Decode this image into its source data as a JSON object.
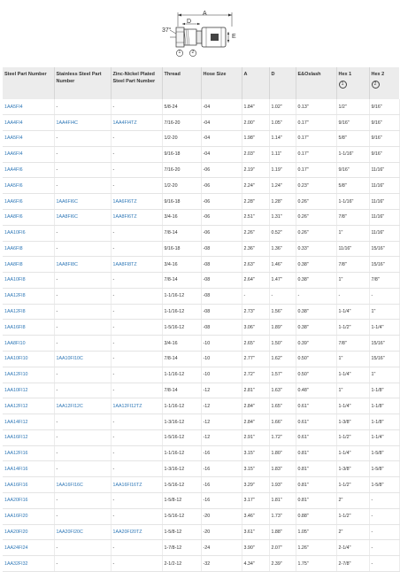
{
  "diagram": {
    "angle_label": "37°",
    "dim_a": "A",
    "dim_d": "D",
    "dim_e": "E",
    "marker_1": "1",
    "marker_2": "2"
  },
  "table": {
    "headers": {
      "steel": "Steel Part Number",
      "stainless": "Stainless Steel Part Number",
      "zinc": "Zinc-Nickel Plated Steel Part Number",
      "thread": "Thread",
      "hose": "Hose Size",
      "a": "A",
      "d": "D",
      "e": "E&Oslash",
      "hex1": "Hex 1",
      "hex1_icon": "1",
      "hex2": "Hex 2",
      "hex2_icon": "2"
    },
    "rows": [
      [
        "1AA5FI4",
        "-",
        "-",
        "5/8-24",
        "-04",
        "1.84\"",
        "1.02\"",
        "0.13\"",
        "1/2\"",
        "9/16\""
      ],
      [
        "1AA4FI4",
        "1AA4FI4C",
        "1AA4FI4TZ",
        "7/16-20",
        "-04",
        "2.00\"",
        "1.05\"",
        "0.17\"",
        "9/16\"",
        "9/16\""
      ],
      [
        "1AA5FI4",
        "-",
        "-",
        "1/2-20",
        "-04",
        "1.98\"",
        "1.14\"",
        "0.17\"",
        "5/8\"",
        "9/16\""
      ],
      [
        "1AA6FI4",
        "-",
        "-",
        "9/16-18",
        "-04",
        "2.03\"",
        "1.11\"",
        "0.17\"",
        "1-1/16\"",
        "9/16\""
      ],
      [
        "1AA4FI6",
        "-",
        "-",
        "7/16-20",
        "-06",
        "2.19\"",
        "1.19\"",
        "0.17\"",
        "9/16\"",
        "11/16\""
      ],
      [
        "1AA5FI6",
        "-",
        "-",
        "1/2-20",
        "-06",
        "2.24\"",
        "1.24\"",
        "0.23\"",
        "5/8\"",
        "11/16\""
      ],
      [
        "1AA6FI6",
        "1AA6FI6C",
        "1AA6FI6TZ",
        "9/16-18",
        "-06",
        "2.28\"",
        "1.28\"",
        "0.26\"",
        "1-1/16\"",
        "11/16\""
      ],
      [
        "1AA8FI6",
        "1AA8FI6C",
        "1AA8FI6TZ",
        "3/4-16",
        "-06",
        "2.51\"",
        "1.31\"",
        "0.26\"",
        "7/8\"",
        "11/16\""
      ],
      [
        "1AA10FI6",
        "-",
        "-",
        "7/8-14",
        "-06",
        "2.26\"",
        "0.52\"",
        "0.26\"",
        "1\"",
        "11/16\""
      ],
      [
        "1AA6FI8",
        "-",
        "-",
        "9/16-18",
        "-08",
        "2.36\"",
        "1.36\"",
        "0.33\"",
        "11/16\"",
        "15/16\""
      ],
      [
        "1AA8FI8",
        "1AA8FI8C",
        "1AA8FI8TZ",
        "3/4-16",
        "-08",
        "2.63\"",
        "1.46\"",
        "0.38\"",
        "7/8\"",
        "15/16\""
      ],
      [
        "1AA10FI8",
        "-",
        "-",
        "7/8-14",
        "-08",
        "2.64\"",
        "1.47\"",
        "0.38\"",
        "1\"",
        "7/8\""
      ],
      [
        "1AA12FI8",
        "-",
        "-",
        "1-1/16-12",
        "-08",
        "-",
        "-",
        "-",
        "-",
        "-"
      ],
      [
        "1AA12FI8",
        "-",
        "-",
        "1-1/16-12",
        "-08",
        "2.73\"",
        "1.56\"",
        "0.38\"",
        "1-1/4\"",
        "1\""
      ],
      [
        "1AA16FI8",
        "-",
        "-",
        "1-5/16-12",
        "-08",
        "3.06\"",
        "1.89\"",
        "0.38\"",
        "1-1/2\"",
        "1-1/4\""
      ],
      [
        "1AA8FI10",
        "-",
        "-",
        "3/4-16",
        "-10",
        "2.65\"",
        "1.50\"",
        "0.39\"",
        "7/8\"",
        "15/16\""
      ],
      [
        "1AA10FI10",
        "1AA10FI10C",
        "-",
        "7/8-14",
        "-10",
        "2.77\"",
        "1.62\"",
        "0.50\"",
        "1\"",
        "15/16\""
      ],
      [
        "1AA12FI10",
        "-",
        "-",
        "1-1/16-12",
        "-10",
        "2.72\"",
        "1.57\"",
        "0.50\"",
        "1-1/4\"",
        "1\""
      ],
      [
        "1AA10FI12",
        "-",
        "-",
        "7/8-14",
        "-12",
        "2.81\"",
        "1.63\"",
        "0.48\"",
        "1\"",
        "1-1/8\""
      ],
      [
        "1AA12FI12",
        "1AA12FI12C",
        "1AA12FI12TZ",
        "1-1/16-12",
        "-12",
        "2.84\"",
        "1.65\"",
        "0.61\"",
        "1-1/4\"",
        "1-1/8\""
      ],
      [
        "1AA14FI12",
        "-",
        "-",
        "1-3/16-12",
        "-12",
        "2.84\"",
        "1.66\"",
        "0.61\"",
        "1-3/8\"",
        "1-1/8\""
      ],
      [
        "1AA16FI12",
        "-",
        "-",
        "1-5/16-12",
        "-12",
        "2.91\"",
        "1.72\"",
        "0.61\"",
        "1-1/2\"",
        "1-1/4\""
      ],
      [
        "1AA12FI16",
        "-",
        "-",
        "1-1/16-12",
        "-16",
        "3.15\"",
        "1.80\"",
        "0.81\"",
        "1-1/4\"",
        "1-5/8\""
      ],
      [
        "1AA14FI16",
        "-",
        "-",
        "1-3/16-12",
        "-16",
        "3.15\"",
        "1.83\"",
        "0.81\"",
        "1-3/8\"",
        "1-5/8\""
      ],
      [
        "1AA16FI16",
        "1AA16FI16C",
        "1AA16FI16TZ",
        "1-5/16-12",
        "-16",
        "3.29\"",
        "1.93\"",
        "0.81\"",
        "1-1/2\"",
        "1-5/8\""
      ],
      [
        "1AA20FI16",
        "-",
        "-",
        "1-5/8-12",
        "-16",
        "3.17\"",
        "1.81\"",
        "0.81\"",
        "2\"",
        "-"
      ],
      [
        "1AA16FI20",
        "-",
        "-",
        "1-5/16-12",
        "-20",
        "3.46\"",
        "1.73\"",
        "0.88\"",
        "1-1/2\"",
        "-"
      ],
      [
        "1AA20FI20",
        "1AA20FI20C",
        "1AA20FI20TZ",
        "1-5/8-12",
        "-20",
        "3.61\"",
        "1.88\"",
        "1.05\"",
        "2\"",
        "-"
      ],
      [
        "1AA24FI24",
        "-",
        "-",
        "1-7/8-12",
        "-24",
        "3.90\"",
        "2.07\"",
        "1.26\"",
        "2-1/4\"",
        "-"
      ],
      [
        "1AA32FI32",
        "-",
        "-",
        "2-1/2-12",
        "-32",
        "4.34\"",
        "2.39\"",
        "1.75\"",
        "2-7/8\"",
        "-"
      ]
    ]
  }
}
